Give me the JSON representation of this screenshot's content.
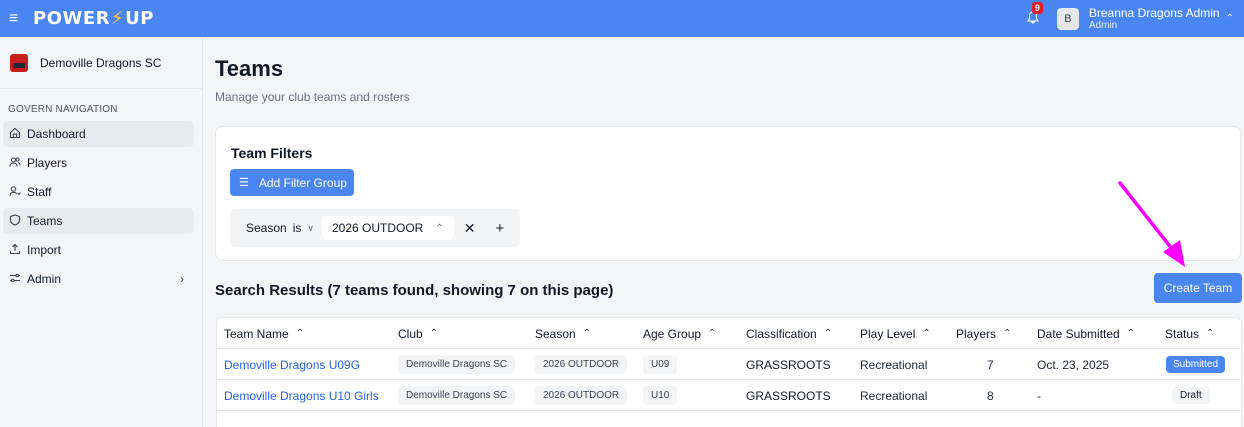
{
  "topbar": {
    "brand_left": "POWER",
    "brand_bolt": "⚡",
    "brand_right": "UP",
    "notification_count": "9",
    "avatar_initial": "B",
    "user_name": "Breanna Dragons Admin",
    "user_role": "Admin"
  },
  "sidebar": {
    "club_name": "Demoville Dragons SC",
    "heading": "GOVERN NAVIGATION",
    "items": [
      {
        "label": "Dashboard",
        "icon": "home-icon"
      },
      {
        "label": "Players",
        "icon": "users-icon"
      },
      {
        "label": "Staff",
        "icon": "staff-icon"
      },
      {
        "label": "Teams",
        "icon": "shield-icon"
      },
      {
        "label": "Import",
        "icon": "upload-icon"
      },
      {
        "label": "Admin",
        "icon": "settings-icon"
      }
    ]
  },
  "main": {
    "title": "Teams",
    "subtitle": "Manage your club teams and rosters",
    "filters": {
      "title": "Team Filters",
      "add_button": "Add Filter Group",
      "field": "Season",
      "operator": "is",
      "value": "2026 OUTDOOR"
    },
    "results_title": "Search Results (7 teams found, showing 7 on this page)",
    "create_button": "Create Team",
    "table": {
      "columns": [
        "Team Name",
        "Club",
        "Season",
        "Age Group",
        "Classification",
        "Play Level",
        "Players",
        "Date Submitted",
        "Status"
      ],
      "rows": [
        {
          "team": "Demoville Dragons U09G",
          "club": "Demoville Dragons SC",
          "season": "2026 OUTDOOR",
          "age": "U09",
          "classification": "GRASSROOTS",
          "level": "Recreational",
          "players": "7",
          "date": "Oct. 23, 2025",
          "status": "Submitted"
        },
        {
          "team": "Demoville Dragons U10 Girls",
          "club": "Demoville Dragons SC",
          "season": "2026 OUTDOOR",
          "age": "U10",
          "classification": "GRASSROOTS",
          "level": "Recreational",
          "players": "8",
          "date": "-",
          "status": "Draft"
        }
      ]
    }
  },
  "colors": {
    "primary": "#4a86f2",
    "annotation_arrow": "#ff00ff",
    "badge": "#e11d2a"
  }
}
